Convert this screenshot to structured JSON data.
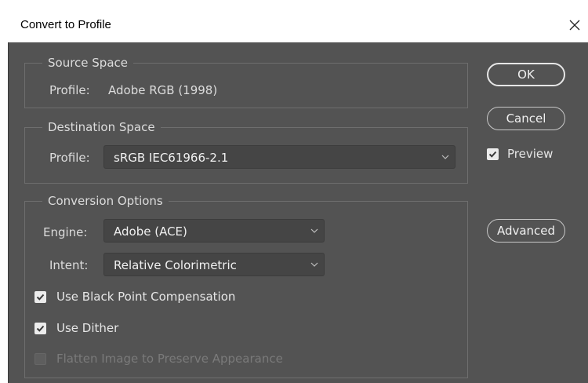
{
  "window": {
    "title": "Convert to Profile"
  },
  "source_space": {
    "legend": "Source Space",
    "profile_label": "Profile:",
    "profile_value": "Adobe RGB (1998)"
  },
  "destination_space": {
    "legend": "Destination Space",
    "profile_label": "Profile:",
    "profile_selected": "sRGB IEC61966-2.1"
  },
  "conversion_options": {
    "legend": "Conversion Options",
    "engine_label": "Engine:",
    "engine_selected": "Adobe (ACE)",
    "intent_label": "Intent:",
    "intent_selected": "Relative Colorimetric",
    "black_point": {
      "label": "Use Black Point Compensation",
      "checked": true
    },
    "dither": {
      "label": "Use Dither",
      "checked": true
    },
    "flatten": {
      "label": "Flatten Image to Preserve Appearance",
      "checked": false,
      "disabled": true
    }
  },
  "buttons": {
    "ok": "OK",
    "cancel": "Cancel",
    "advanced": "Advanced"
  },
  "preview": {
    "label": "Preview",
    "checked": true
  },
  "colors": {
    "panel_bg": "#535353",
    "field_bg": "#454545",
    "text": "#dcdcdc",
    "titlebar_bg": "#ffffff"
  },
  "icons": {
    "close": "close-icon",
    "dropdown": "chevron-down-icon",
    "checkmark": "checkmark-icon"
  }
}
